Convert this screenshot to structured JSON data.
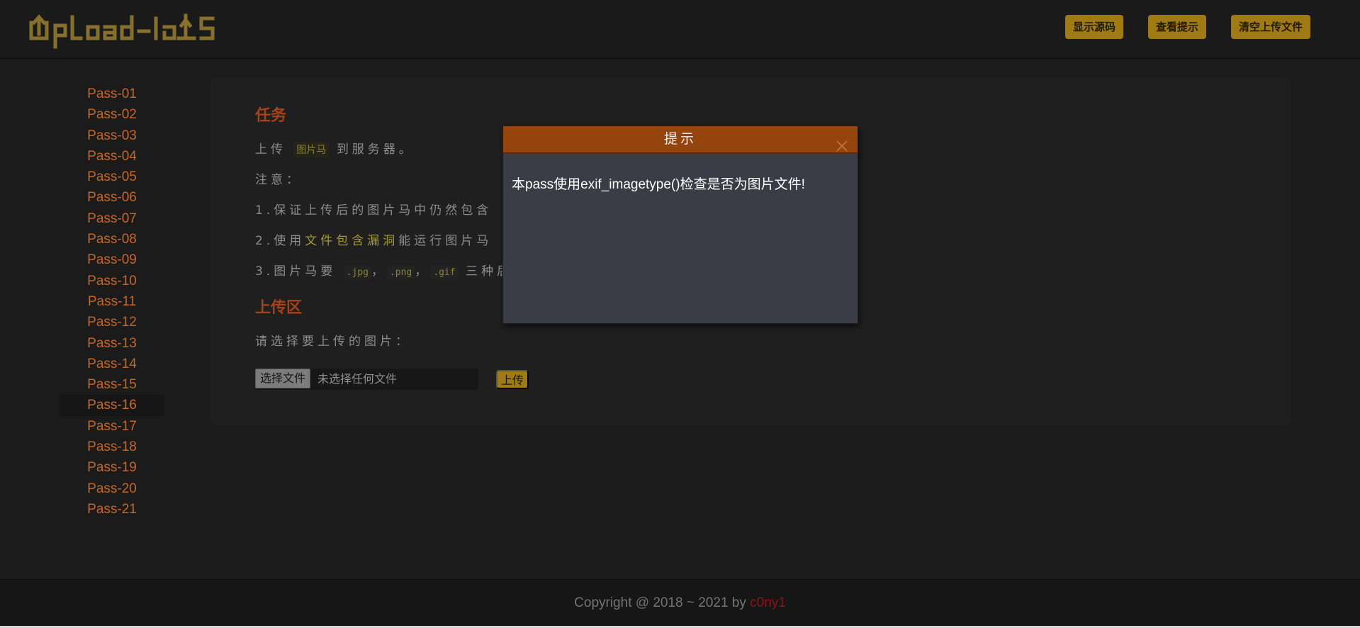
{
  "header": {
    "logo_text": "Upload-labs",
    "buttons": [
      "显示源码",
      "查看提示",
      "清空上传文件"
    ]
  },
  "sidebar": {
    "items": [
      "Pass-01",
      "Pass-02",
      "Pass-03",
      "Pass-04",
      "Pass-05",
      "Pass-06",
      "Pass-07",
      "Pass-08",
      "Pass-09",
      "Pass-10",
      "Pass-11",
      "Pass-12",
      "Pass-13",
      "Pass-14",
      "Pass-15",
      "Pass-16",
      "Pass-17",
      "Pass-18",
      "Pass-19",
      "Pass-20",
      "Pass-21"
    ],
    "active": "Pass-16"
  },
  "task": {
    "title": "任务",
    "line1_pre": "上传",
    "line1_tag": "图片马",
    "line1_post": "到服务器。",
    "note": "注意：",
    "item1": "1.保证上传后的图片马中仍然包含",
    "item2_pre": "2.使用",
    "item2_link": "文件包含漏洞",
    "item2_post": "能运行图片马",
    "item3_pre": "3.图片马要",
    "ext_jpg": ".jpg",
    "ext_png": ".png",
    "ext_gif": ".gif",
    "sep": "，",
    "item3_post": "三种后"
  },
  "upload": {
    "title": "上传区",
    "prompt": "请选择要上传的图片：",
    "choose_button": "选择文件",
    "file_status": "未选择任何文件",
    "submit_button": "上传"
  },
  "dialog": {
    "title": "提示",
    "message": "本pass使用exif_imagetype()检查是否为图片文件!"
  },
  "footer": {
    "copyright": "Copyright @ 2018 ~ 2021 by ",
    "author": "c0ny1"
  },
  "colors": {
    "accent": "#a07a12",
    "dialog_header": "#96440e",
    "sidebar_link": "#c5652a"
  }
}
